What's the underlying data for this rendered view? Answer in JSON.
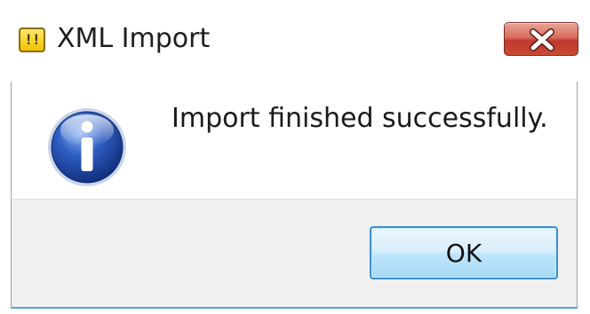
{
  "window": {
    "title": "XML Import",
    "app_icon": "app-warning-icon",
    "app_icon_glyph": "!!",
    "close_icon": "close-icon"
  },
  "dialog": {
    "icon": "info-icon",
    "message": "Import finished successfully.",
    "ok_label": "OK"
  },
  "colors": {
    "close_button": "#c9473a",
    "ok_border": "#3c8fd0",
    "footer_bg": "#f0f0f0",
    "info_blue": "#1f4fb4"
  }
}
